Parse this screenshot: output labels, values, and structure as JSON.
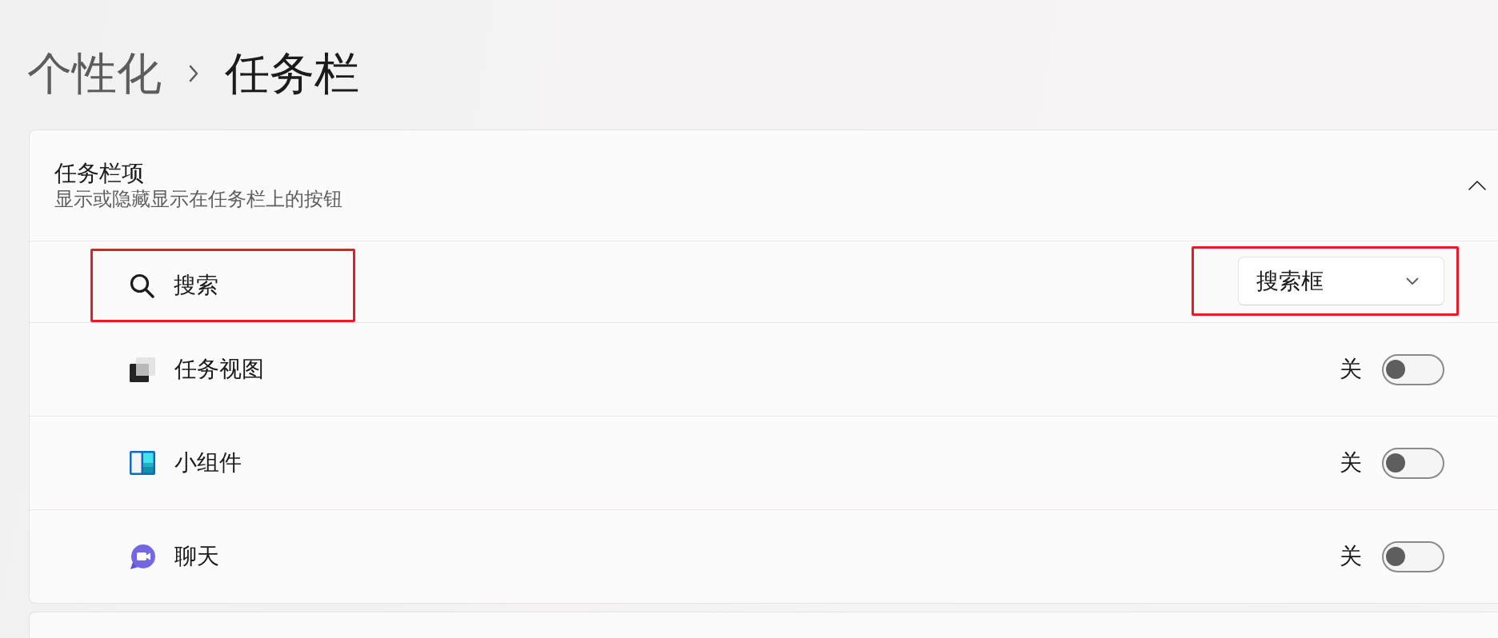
{
  "breadcrumb": [
    {
      "label": "个性化",
      "current": false
    },
    {
      "label": "任务栏",
      "current": true
    }
  ],
  "section": {
    "title": "任务栏项",
    "subtitle": "显示或隐藏显示在任务栏上的按钮",
    "expanded": true,
    "items": [
      {
        "kind": "dropdown",
        "label": "搜索",
        "value": "搜索框",
        "highlighted": true
      },
      {
        "kind": "toggle",
        "label": "任务视图",
        "state_label": "关",
        "on": false,
        "highlighted": false
      },
      {
        "kind": "toggle",
        "label": "小组件",
        "state_label": "关",
        "on": false,
        "highlighted": false
      },
      {
        "kind": "toggle",
        "label": "聊天",
        "state_label": "关",
        "on": false,
        "highlighted": false
      }
    ]
  }
}
